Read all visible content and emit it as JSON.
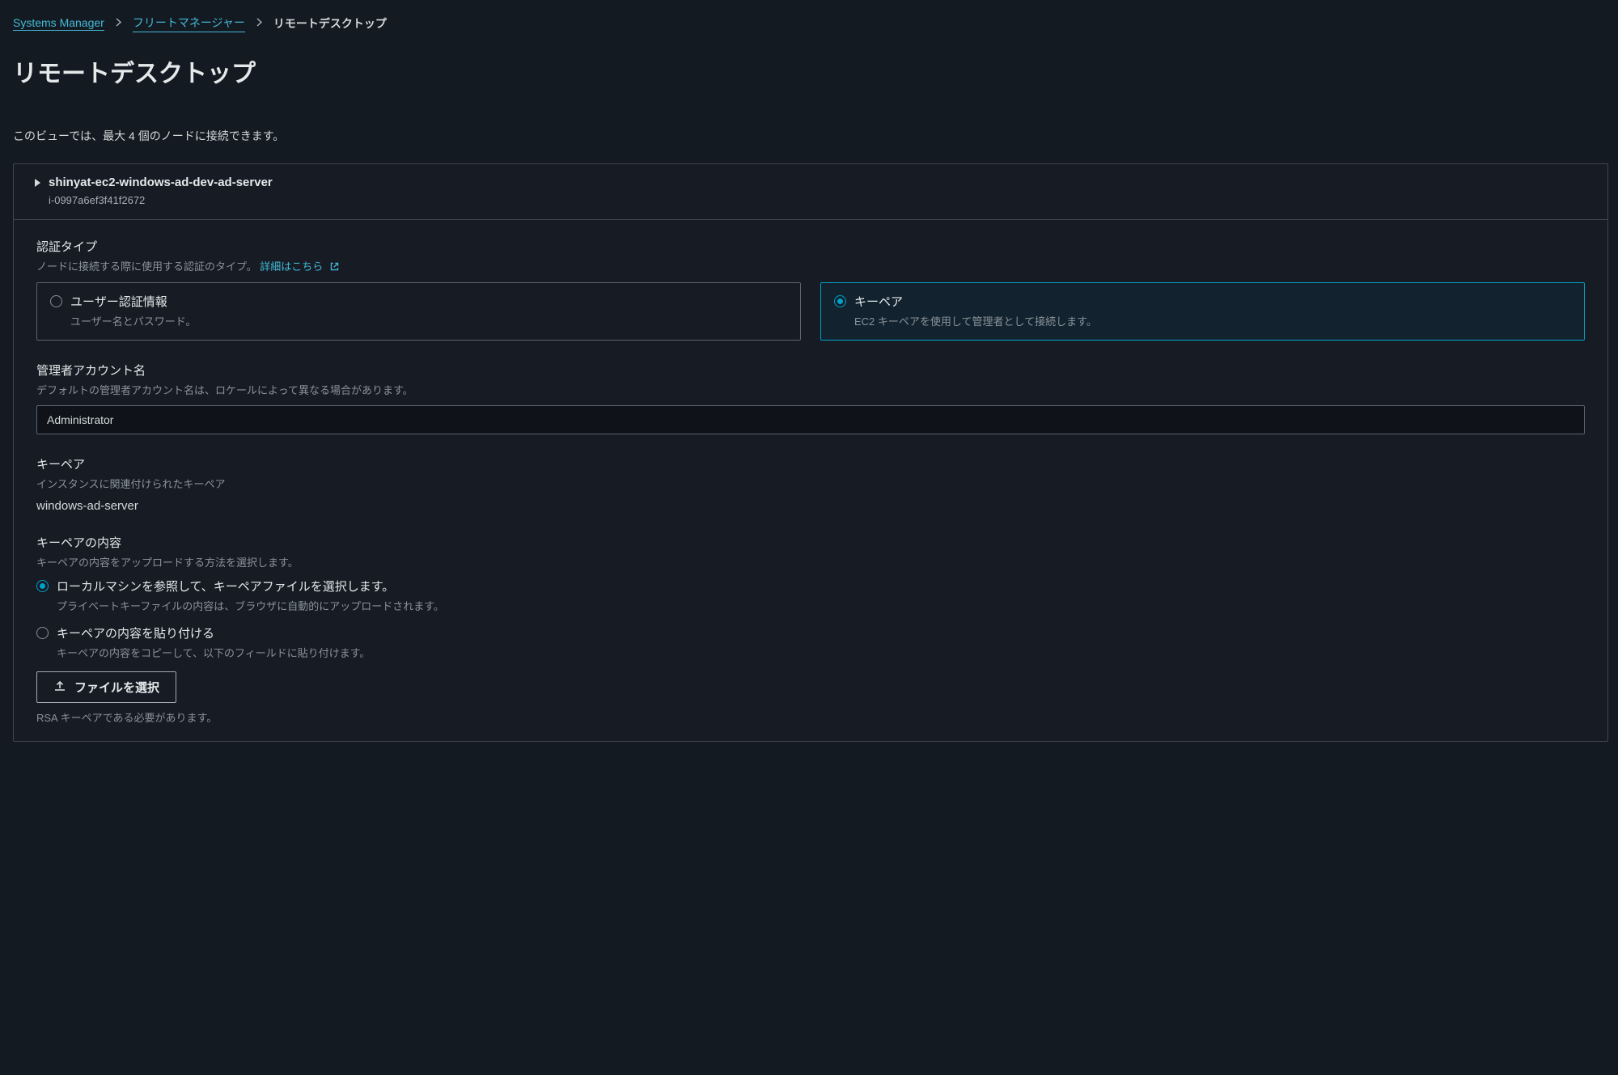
{
  "breadcrumb": {
    "link1": "Systems Manager",
    "link2": "フリートマネージャー",
    "current": "リモートデスクトップ"
  },
  "page_title": "リモートデスクトップ",
  "view_note": "このビューでは、最大 4 個のノードに接続できます。",
  "node": {
    "name": "shinyat-ec2-windows-ad-dev-ad-server",
    "id": "i-0997a6ef3f41f2672"
  },
  "auth_type": {
    "label": "認証タイプ",
    "help_prefix": "ノードに接続する際に使用する認証のタイプ。",
    "learn_more": "詳細はこちら",
    "options": {
      "user": {
        "title": "ユーザー認証情報",
        "desc": "ユーザー名とパスワード。"
      },
      "keypair": {
        "title": "キーペア",
        "desc": "EC2 キーペアを使用して管理者として接続します。"
      }
    }
  },
  "admin_account": {
    "label": "管理者アカウント名",
    "help": "デフォルトの管理者アカウント名は、ロケールによって異なる場合があります。",
    "value": "Administrator"
  },
  "keypair": {
    "label": "キーペア",
    "help": "インスタンスに関連付けられたキーペア",
    "value": "windows-ad-server"
  },
  "keypair_content": {
    "label": "キーペアの内容",
    "help": "キーペアの内容をアップロードする方法を選択します。",
    "browse": {
      "title": "ローカルマシンを参照して、キーペアファイルを選択します。",
      "desc": "プライベートキーファイルの内容は、ブラウザに自動的にアップロードされます。"
    },
    "paste": {
      "title": "キーペアの内容を貼り付ける",
      "desc": "キーペアの内容をコピーして、以下のフィールドに貼り付けます。"
    },
    "file_button": "ファイルを選択",
    "file_hint": "RSA キーペアである必要があります。"
  }
}
